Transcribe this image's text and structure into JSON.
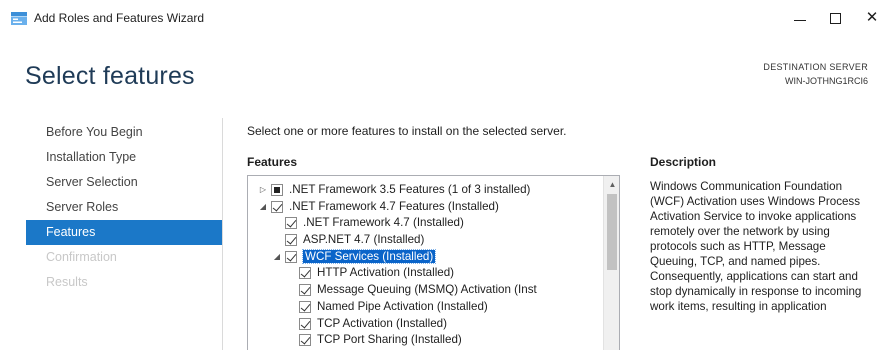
{
  "window": {
    "title": "Add Roles and Features Wizard",
    "minimize_icon": "minimize-icon",
    "maximize_icon": "maximize-icon",
    "close_glyph": "✕"
  },
  "header": {
    "page_title": "Select features",
    "destination_label": "DESTINATION SERVER",
    "destination_server": "WIN-JOTHNG1RCI6"
  },
  "nav": {
    "items": [
      {
        "label": "Before You Begin",
        "state": "normal"
      },
      {
        "label": "Installation Type",
        "state": "normal"
      },
      {
        "label": "Server Selection",
        "state": "normal"
      },
      {
        "label": "Server Roles",
        "state": "normal"
      },
      {
        "label": "Features",
        "state": "active"
      },
      {
        "label": "Confirmation",
        "state": "disabled"
      },
      {
        "label": "Results",
        "state": "disabled"
      }
    ]
  },
  "main": {
    "instruction": "Select one or more features to install on the selected server.",
    "features_heading": "Features",
    "description_heading": "Description",
    "description_text": "Windows Communication Foundation (WCF) Activation uses Windows Process Activation Service to invoke applications remotely over the network by using protocols such as HTTP, Message Queuing, TCP, and named pipes. Consequently, applications can start and stop dynamically in response to incoming work items, resulting in application"
  },
  "tree": [
    {
      "label": ".NET Framework 3.5 Features (1 of 3 installed)",
      "level": 0,
      "expander": "collapsed",
      "check": "partial"
    },
    {
      "label": ".NET Framework 4.7 Features (Installed)",
      "level": 0,
      "expander": "expanded",
      "check": "checked"
    },
    {
      "label": ".NET Framework 4.7 (Installed)",
      "level": 1,
      "expander": "none",
      "check": "checked"
    },
    {
      "label": "ASP.NET 4.7 (Installed)",
      "level": 1,
      "expander": "none",
      "check": "checked"
    },
    {
      "label": "WCF Services (Installed)",
      "level": 1,
      "expander": "expanded",
      "check": "checked",
      "selected": true
    },
    {
      "label": "HTTP Activation (Installed)",
      "level": 2,
      "expander": "none",
      "check": "checked"
    },
    {
      "label": "Message Queuing (MSMQ) Activation (Inst",
      "level": 2,
      "expander": "none",
      "check": "checked"
    },
    {
      "label": "Named Pipe Activation (Installed)",
      "level": 2,
      "expander": "none",
      "check": "checked"
    },
    {
      "label": "TCP Activation (Installed)",
      "level": 2,
      "expander": "none",
      "check": "checked"
    },
    {
      "label": "TCP Port Sharing (Installed)",
      "level": 2,
      "expander": "none",
      "check": "checked"
    }
  ],
  "colors": {
    "accent": "#1b78c8",
    "selection": "#0a64c9",
    "title": "#1f3b57",
    "disabled": "#c8c8c8"
  }
}
